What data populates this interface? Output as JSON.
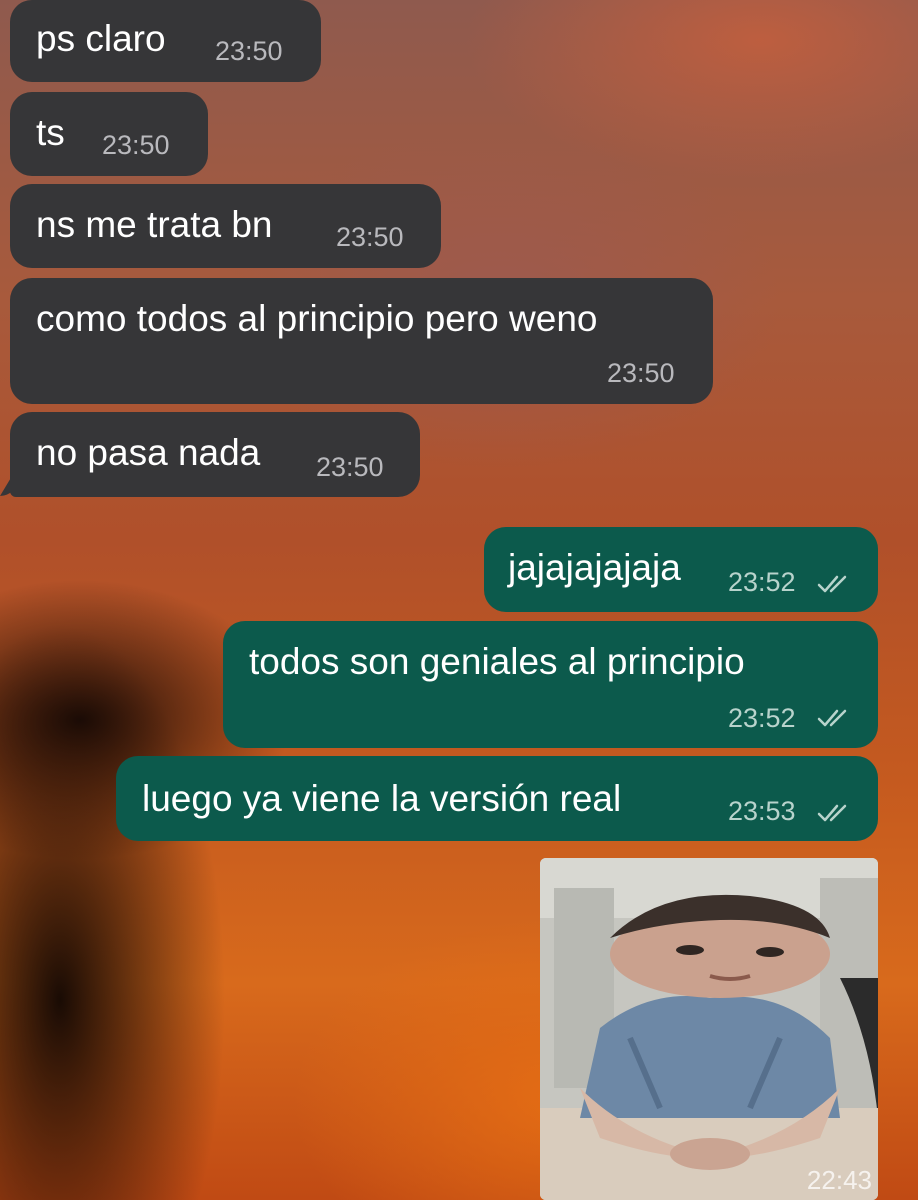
{
  "messages": [
    {
      "direction": "incoming",
      "text": "ps claro",
      "time": "23:50"
    },
    {
      "direction": "incoming",
      "text": "ts",
      "time": "23:50"
    },
    {
      "direction": "incoming",
      "text": "ns me trata bn",
      "time": "23:50"
    },
    {
      "direction": "incoming",
      "text": "como todos al principio pero weno",
      "time": "23:50"
    },
    {
      "direction": "incoming",
      "text": "no pasa nada",
      "time": "23:50"
    },
    {
      "direction": "outgoing",
      "text": "jajajajajaja",
      "time": "23:52",
      "status_icon": "double-check-icon"
    },
    {
      "direction": "outgoing",
      "text": "todos son geniales al principio",
      "time": "23:52",
      "status_icon": "double-check-icon"
    },
    {
      "direction": "outgoing",
      "text": "luego ya viene la versión real",
      "time": "23:53",
      "status_icon": "double-check-icon"
    }
  ],
  "image_message": {
    "direction": "outgoing",
    "description_icon": "meme-photo-icon",
    "time": "22:43"
  },
  "colors": {
    "incoming_bubble": "#363638",
    "outgoing_bubble": "#0c5a4c",
    "text": "#ffffff",
    "timestamp": "#b9b9bd"
  }
}
